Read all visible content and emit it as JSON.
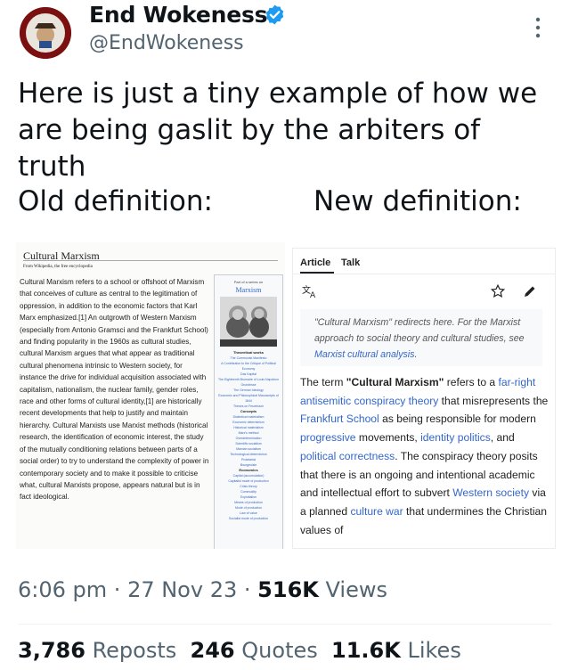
{
  "author": {
    "display_name": "End Wokeness",
    "handle": "@EndWokeness",
    "avatar_text_top": "SUPPORT",
    "avatar_text_bottom": "FARMER TRIBE"
  },
  "tweet": {
    "text": "Here is just a tiny example of how we are being gaslit by the arbiters of truth",
    "old_label": "Old definition:",
    "new_label": "New definition:"
  },
  "old_definition": {
    "title": "Cultural Marxism",
    "subtitle": "From Wikipedia, the free encyclopedia",
    "paragraph": "Cultural Marxism refers to a school or offshoot of Marxism that conceives of culture as central to the legitimation of oppression, in addition to the economic factors that Karl Marx emphasized.[1] An outgrowth of Western Marxism (especially from Antonio Gramsci and the Frankfurt School) and finding popularity in the 1960s as cultural studies, cultural Marxism argues that what appear as traditional cultural phenomena intrinsic to Western society, for instance the drive for individual acquisition associated with capitalism, nationalism, the nuclear family, gender roles, race and other forms of cultural identity,[1] are historically recent developments that help to justify and maintain hierarchy. Cultural Marxists use Marxist methods (historical research, the identification of economic interest, the study of the mutually conditioning relations between parts of a social order) to try to understand the complexity of power in contemporary society and to make it possible to criticise what, cultural Marxists propose, appears natural but is in fact ideological.",
    "sidebar": {
      "series": "Part of a series on",
      "title": "Marxism",
      "sections": [
        {
          "heading": "Theoretical works",
          "items": [
            "The Communist Manifesto",
            "A Contribution to the Critique of Political Economy",
            "Das Kapital",
            "The Eighteenth Brumaire of Louis Napoleon",
            "Grundrisse",
            "The German Ideology",
            "Economic and Philosophical Manuscripts of 1844",
            "Theses on Feuerbach"
          ]
        },
        {
          "heading": "Concepts",
          "items": [
            "Dialectical materialism",
            "Economic determinism",
            "Historical materialism",
            "Marx's method",
            "Overdetermination",
            "Scientific socialism",
            "Marxian socialism",
            "Technological determinism",
            "Proletariat",
            "Bourgeoisie"
          ]
        },
        {
          "heading": "Economics",
          "items": [
            "Capital (accumulation)",
            "Capitalist mode of production",
            "Crisis theory",
            "Commodity",
            "Exploitation",
            "Means of production",
            "Mode of production",
            "Law of value",
            "Socialist mode of production"
          ]
        }
      ]
    }
  },
  "new_definition": {
    "tabs": [
      "Article",
      "Talk"
    ],
    "hatnote": "\"Cultural Marxism\" redirects here. For the Marxist approach to social theory and cultural studies, see",
    "hatnote_link": "Marxist cultural analysis",
    "body": [
      {
        "t": "The term "
      },
      {
        "t": "\"Cultural Marxism\"",
        "b": true
      },
      {
        "t": " refers to a "
      },
      {
        "t": "far-right antisemitic conspiracy theory",
        "l": true
      },
      {
        "t": " that misrepresents the "
      },
      {
        "t": "Frankfurt School",
        "l": true
      },
      {
        "t": " as being responsible for modern "
      },
      {
        "t": "progressive",
        "l": true
      },
      {
        "t": " movements, "
      },
      {
        "t": "identity politics",
        "l": true
      },
      {
        "t": ", and "
      },
      {
        "t": "political correctness",
        "l": true
      },
      {
        "t": ". The conspiracy theory posits that there is an ongoing and intentional academic and intellectual effort to subvert "
      },
      {
        "t": "Western society",
        "l": true
      },
      {
        "t": " via a planned "
      },
      {
        "t": "culture war",
        "l": true
      },
      {
        "t": " that undermines the Christian values of"
      }
    ]
  },
  "meta": {
    "time": "6:06 pm",
    "date": "27 Nov 23",
    "views_count": "516K",
    "views_label": "Views",
    "separator": "·"
  },
  "stats": {
    "reposts_count": "3,786",
    "reposts_label": "Reposts",
    "quotes_count": "246",
    "quotes_label": "Quotes",
    "likes_count": "11.6K",
    "likes_label": "Likes"
  },
  "colors": {
    "verified": "#1d9bf0",
    "link": "#3366cc",
    "secondary_text": "#536471"
  }
}
